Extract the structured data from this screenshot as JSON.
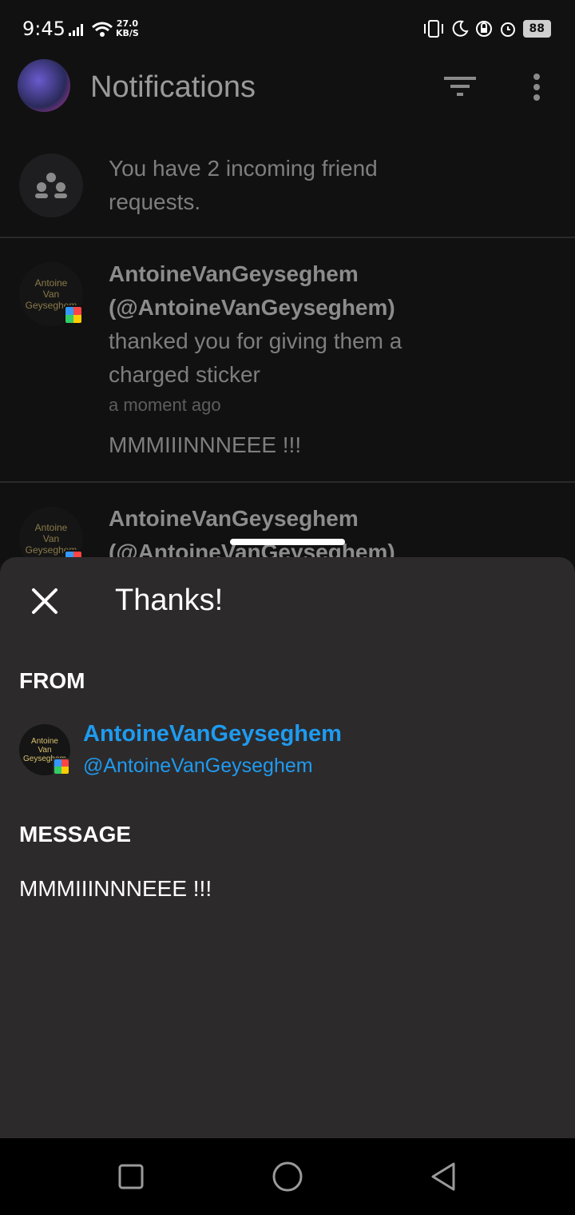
{
  "status_bar": {
    "time": "9:45",
    "speed_value": "27.0",
    "speed_unit": "KB/S",
    "battery": "88"
  },
  "app_bar": {
    "title": "Notifications",
    "icons": [
      "avatar",
      "filter-icon",
      "more-vert-icon"
    ]
  },
  "notifications": [
    {
      "type": "friend_requests",
      "text_line1": "You have 2 incoming friend",
      "text_line2": "requests."
    },
    {
      "type": "thanks",
      "avatar_text": [
        "Antoine",
        "Van",
        "Geyseghem"
      ],
      "name": "AntoineVanGeyseghem",
      "handle": "(@AntoineVanGeyseghem)",
      "text_line1": "thanked you for giving them a",
      "text_line2": "charged sticker",
      "time": "a moment ago",
      "message": "MMMIIINNNEEE !!!"
    },
    {
      "type": "thanks",
      "avatar_text": [
        "Antoine",
        "Van",
        "Geyseghem"
      ],
      "name": "AntoineVanGeyseghem",
      "handle": "(@AntoineVanGeyseghem)"
    }
  ],
  "sheet": {
    "title": "Thanks!",
    "from_label": "FROM",
    "from_name": "AntoineVanGeyseghem",
    "from_handle": "@AntoineVanGeyseghem",
    "from_avatar_text": [
      "Antoine",
      "Van",
      "Geyseghem"
    ],
    "message_label": "MESSAGE",
    "message": "MMMIIINNNEEE !!!"
  },
  "nav_bar": {
    "buttons": [
      "recents-icon",
      "home-icon",
      "back-icon"
    ]
  },
  "colors": {
    "accent": "#1e9bf0",
    "sheet_bg": "#2d2a2b",
    "page_bg": "#111112"
  }
}
